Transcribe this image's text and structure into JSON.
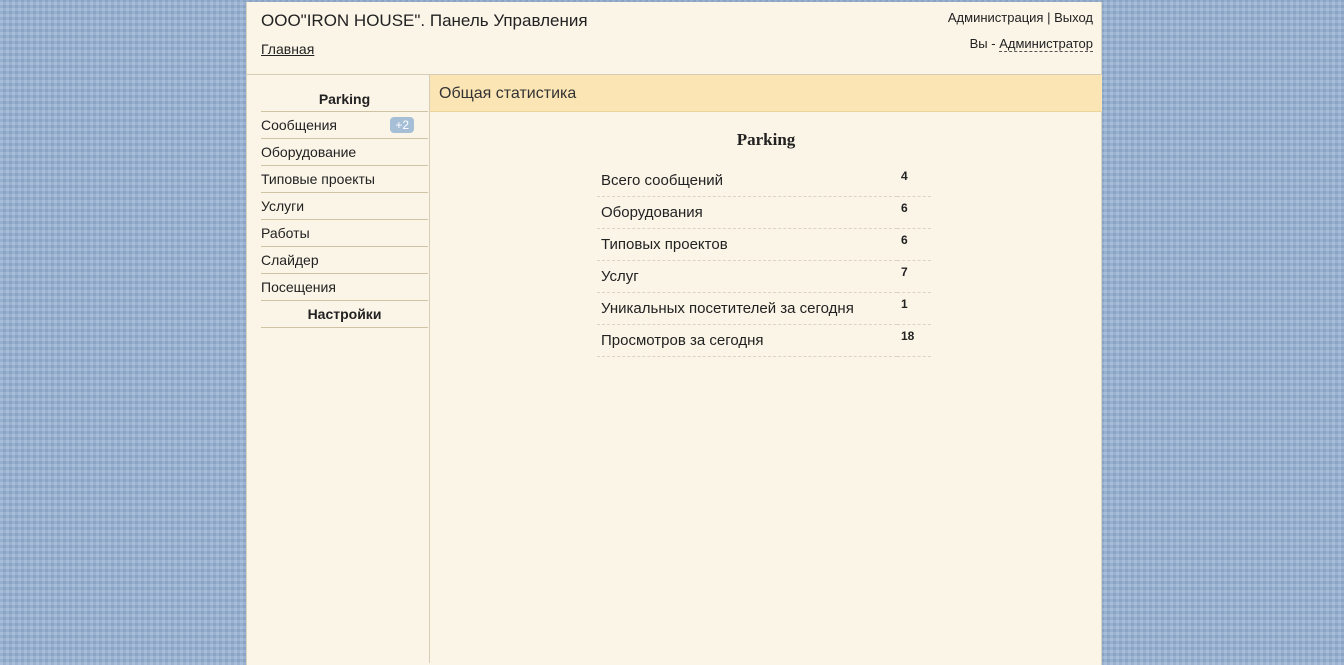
{
  "header": {
    "title": "ООО\"IRON HOUSE\". Панель Управления",
    "home_link": "Главная",
    "admin_link": "Администрация",
    "separator": "|",
    "logout_link": "Выход",
    "user_prefix": "Вы -",
    "user_name": "Администратор"
  },
  "sidebar": {
    "heading": "Parking",
    "items": [
      {
        "label": "Сообщения",
        "badge": "+2"
      },
      {
        "label": "Оборудование"
      },
      {
        "label": "Типовые проекты"
      },
      {
        "label": "Услуги"
      },
      {
        "label": "Работы"
      },
      {
        "label": "Слайдер"
      },
      {
        "label": "Посещения"
      }
    ],
    "settings": "Настройки"
  },
  "main": {
    "section_title": "Общая статистика",
    "stats_title": "Parking",
    "stats": [
      {
        "label": "Всего сообщений",
        "value": "4"
      },
      {
        "label": "Оборудования",
        "value": "6"
      },
      {
        "label": "Типовых проектов",
        "value": "6"
      },
      {
        "label": "Услуг",
        "value": "7"
      },
      {
        "label": "Уникальных посетителей за сегодня",
        "value": "1"
      },
      {
        "label": "Просмотров за сегодня",
        "value": "18"
      }
    ]
  },
  "colors": {
    "page_background": "#95b0d2",
    "panel_background": "#fbf5e8",
    "section_header": "#fbe5b5",
    "badge": "#a6bfd7"
  }
}
